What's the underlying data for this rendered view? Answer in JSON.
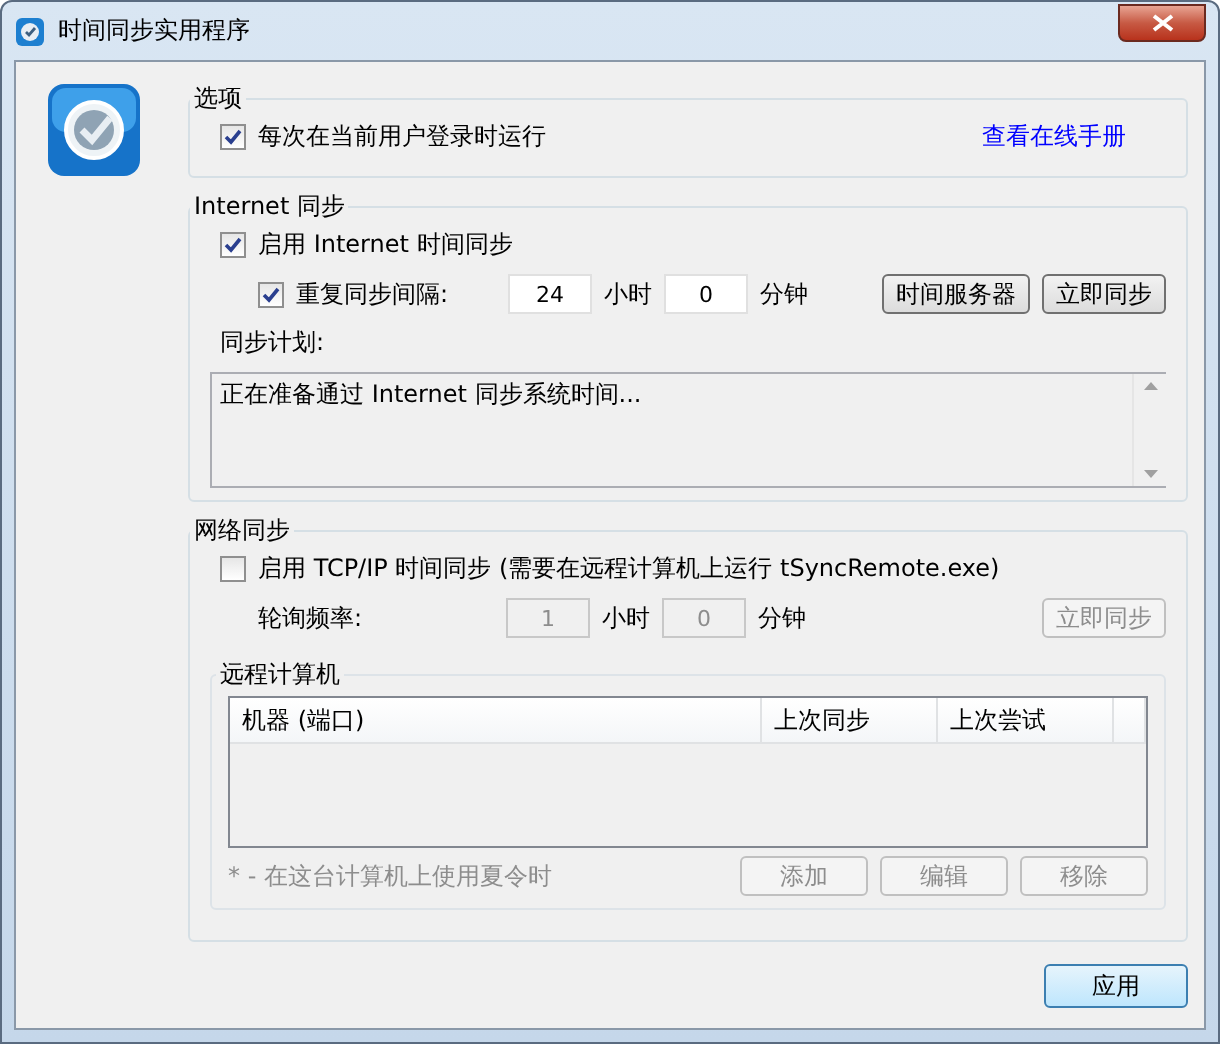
{
  "window": {
    "title": "时间同步实用程序"
  },
  "options": {
    "title": "选项",
    "run_at_login": {
      "label": "每次在当前用户登录时运行",
      "checked": true
    },
    "manual_link": "查看在线手册"
  },
  "internet_sync": {
    "title": "Internet 同步",
    "enable": {
      "label": "启用 Internet 时间同步",
      "checked": true
    },
    "repeat": {
      "label": "重复同步间隔:",
      "checked": true,
      "hours": "24",
      "hours_unit": "小时",
      "minutes": "0",
      "minutes_unit": "分钟"
    },
    "buttons": [
      {
        "label": "时间服务器",
        "disabled": false
      },
      {
        "label": "立即同步",
        "disabled": false
      }
    ],
    "schedule_label": "同步计划:",
    "schedule_text": "正在准备通过 Internet 同步系统时间..."
  },
  "network_sync": {
    "title": "网络同步",
    "enable": {
      "label": "启用 TCP/IP 时间同步 (需要在远程计算机上运行 tSyncRemote.exe)",
      "checked": false
    },
    "poll": {
      "label": "轮询频率:",
      "disabled": true,
      "hours": "1",
      "hours_unit": "小时",
      "minutes": "0",
      "minutes_unit": "分钟"
    },
    "sync_button": {
      "label": "立即同步",
      "disabled": true
    },
    "remote": {
      "title": "远程计算机",
      "columns": [
        "机器 (端口)",
        "上次同步",
        "上次尝试"
      ],
      "note": "* - 在这台计算机上使用夏令时",
      "buttons": [
        {
          "label": "添加",
          "disabled": true
        },
        {
          "label": "编辑",
          "disabled": true
        },
        {
          "label": "移除",
          "disabled": true
        }
      ]
    }
  },
  "apply_button": {
    "label": "应用"
  }
}
